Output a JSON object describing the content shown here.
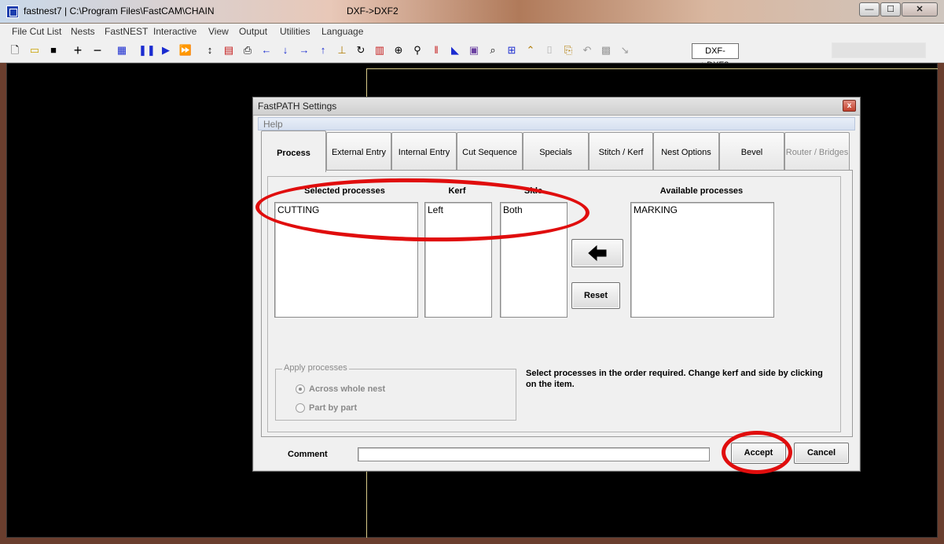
{
  "window": {
    "title": "fastnest7  |  C:\\Program Files\\FastCAM\\CHAIN",
    "center_title": "DXF->DXF2",
    "minimize": "—",
    "maximize": "☐",
    "close": "✕"
  },
  "menu": [
    "File Cut List",
    "Nests",
    "FastNEST",
    "Interactive",
    "View",
    "Output",
    "Utilities",
    "Language"
  ],
  "toolbar": {
    "dxf_button": "DXF->DXF2"
  },
  "dialog": {
    "title": "FastPATH Settings",
    "close": "x",
    "menu_help": "Help",
    "tabs": [
      "Process",
      "External Entry",
      "Internal Entry",
      "Cut Sequence",
      "Specials",
      "Stitch / Kerf",
      "Nest Options",
      "Bevel",
      "Router / Bridges"
    ],
    "active_tab": "Process",
    "selected_processes_header": "Selected processes",
    "kerf_header": "Kerf",
    "side_header": "Side",
    "available_processes_header": "Available processes",
    "selected_processes": [
      "CUTTING"
    ],
    "kerf_values": [
      "Left"
    ],
    "side_values": [
      "Both"
    ],
    "available_processes": [
      "MARKING"
    ],
    "move_button_icon": "left-arrow-icon",
    "reset_label": "Reset",
    "apply_group_label": "Apply processes",
    "apply_options": [
      {
        "label": "Across whole nest",
        "checked": true
      },
      {
        "label": "Part by part",
        "checked": false
      }
    ],
    "hint": "Select processes in the order required. Change kerf and side by clicking on the item.",
    "comment_label": "Comment",
    "comment_value": "",
    "accept_label": "Accept",
    "cancel_label": "Cancel"
  },
  "colors": {
    "annotation": "#e00d0d",
    "workspace": "#000000",
    "sheet_outline": "#d9cc8a"
  }
}
